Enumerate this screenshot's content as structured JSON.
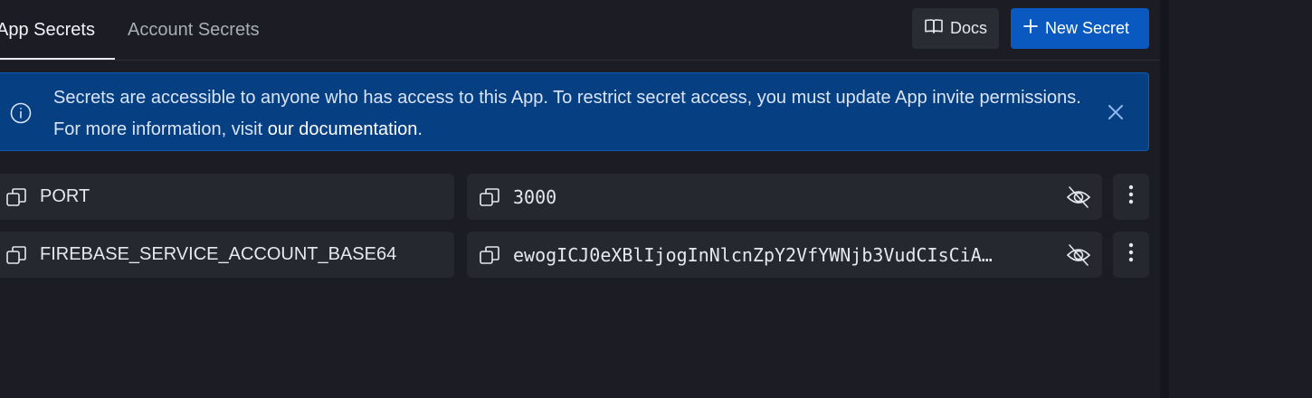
{
  "tabs": [
    {
      "label": "App Secrets",
      "active": true
    },
    {
      "label": "Account Secrets",
      "active": false
    }
  ],
  "toolbar": {
    "docs_label": "Docs",
    "new_secret_label": "New Secret"
  },
  "banner": {
    "text": "Secrets are accessible to anyone who has access to this App. To restrict secret access, you must update App invite permissions. For more information, visit ",
    "link_text": "our documentation",
    "suffix": "."
  },
  "secrets": [
    {
      "key": "PORT",
      "value": "3000"
    },
    {
      "key": "FIREBASE_SERVICE_ACCOUNT_BASE64",
      "value": "ewogICJ0eXBlIjogInNlcnZpY2VfYWNjb3VudCIsCiA…"
    }
  ],
  "icons": {
    "docs": "book-icon",
    "new": "plus-icon",
    "info": "info-icon",
    "close": "close-icon",
    "copy": "copy-icon",
    "eye": "eye-off-icon",
    "menu": "kebab-menu-icon"
  },
  "colors": {
    "background": "#1c1d24",
    "field": "#262830",
    "banner": "#073f83",
    "primary": "#0a59c1"
  }
}
